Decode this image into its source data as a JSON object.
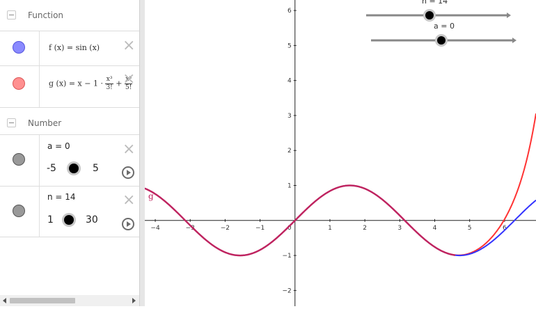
{
  "algebra": {
    "groups": [
      {
        "label": "Function"
      },
      {
        "label": "Number"
      }
    ],
    "functions": [
      {
        "name": "f",
        "expr_prefix": "f (x)  =  sin (x)",
        "color": "#8a8aff"
      },
      {
        "name": "g",
        "expr_prefix": "g (x)  =  x − 1 ·",
        "frac1_num": "x³",
        "frac1_den": "3!",
        "plus": "+",
        "frac2_num": "x⁵",
        "frac2_den": "5!",
        "color": "#ff8080"
      }
    ],
    "numbers": [
      {
        "label": "a = 0",
        "min": "-5",
        "max": "5",
        "value": 0
      },
      {
        "label": "n = 14",
        "min": "1",
        "max": "30",
        "value": 14
      }
    ],
    "hscroll": {
      "fraction": 0.5
    }
  },
  "graph": {
    "x_ticks": [
      "−4",
      "−3",
      "−2",
      "−1",
      "0",
      "1",
      "2",
      "3",
      "4",
      "5",
      "6"
    ],
    "y_ticks": [
      "−2",
      "−1",
      "1",
      "2",
      "3",
      "4",
      "5",
      "6"
    ],
    "g_label": "g",
    "slider_n_label": "n = 14",
    "slider_a_label": "a = 0",
    "f_color": "#3333ff",
    "g_color": "#ff3333",
    "overlap_color": "#c0245f"
  },
  "chart_data": {
    "type": "line",
    "xlim": [
      -4.3,
      6.9
    ],
    "ylim": [
      -2.45,
      6.3
    ],
    "series": [
      {
        "name": "f",
        "function": "sin(x)"
      },
      {
        "name": "g",
        "function": "Taylor polynomial of sin(x) about a = 0, n = 14"
      }
    ]
  }
}
